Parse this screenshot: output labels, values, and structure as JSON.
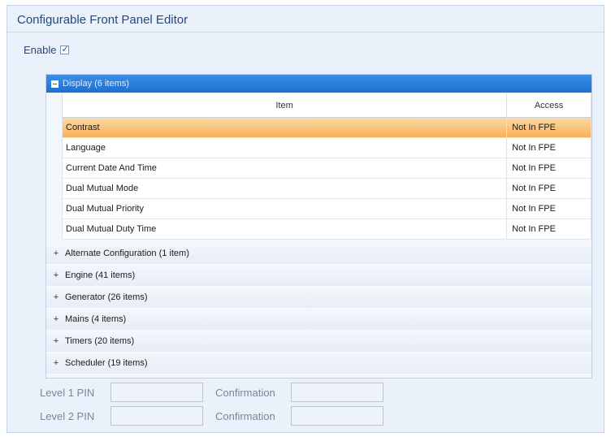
{
  "panel": {
    "title": "Configurable Front Panel Editor",
    "enable_label": "Enable",
    "enable_checked": true
  },
  "tree": {
    "expanded_group": "Display (6 items)",
    "columns": [
      "Item",
      "Access"
    ],
    "rows": [
      {
        "item": "Contrast",
        "access": "Not In FPE",
        "selected": true
      },
      {
        "item": "Language",
        "access": "Not In FPE"
      },
      {
        "item": "Current Date And Time",
        "access": "Not In FPE"
      },
      {
        "item": "Dual Mutual Mode",
        "access": "Not In FPE"
      },
      {
        "item": "Dual Mutual Priority",
        "access": "Not In FPE"
      },
      {
        "item": "Dual Mutual Duty Time",
        "access": "Not In FPE"
      }
    ],
    "collapsed_groups": [
      "Alternate Configuration (1 item)",
      "Engine (41 items)",
      "Generator (26 items)",
      "Mains (4 items)",
      "Timers (20 items)",
      "Scheduler (19 items)"
    ],
    "expand_symbol": "+"
  },
  "pins": {
    "level1_label": "Level 1 PIN",
    "level2_label": "Level 2 PIN",
    "confirmation_label": "Confirmation",
    "level1_value": "",
    "level1_confirm": "",
    "level2_value": "",
    "level2_confirm": ""
  },
  "colors": {
    "header_blue": "#1d6fd2",
    "selected_orange": "#f7b25a",
    "title_text": "#25497a"
  }
}
